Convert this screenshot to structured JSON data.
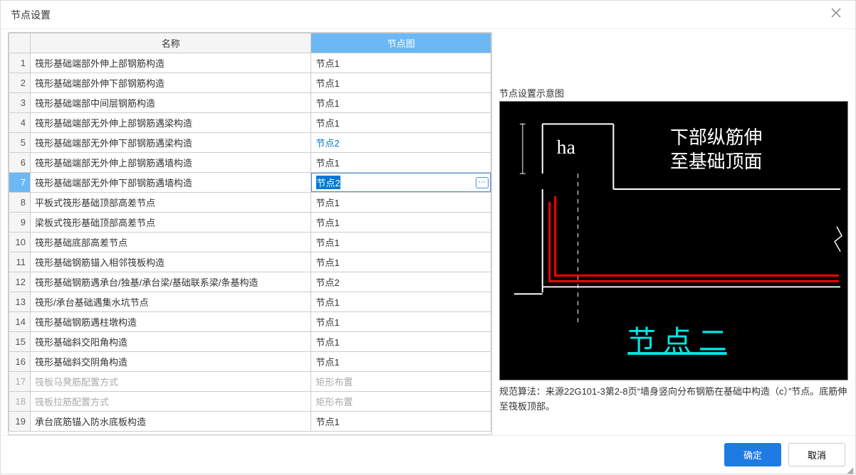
{
  "dialog": {
    "title": "节点设置",
    "ok": "确定",
    "cancel": "取消"
  },
  "table": {
    "headers": {
      "index": "",
      "name": "名称",
      "node": "节点图"
    },
    "rows": [
      {
        "idx": "1",
        "name": "筏形基础端部外伸上部钢筋构造",
        "val": "节点1",
        "state": ""
      },
      {
        "idx": "2",
        "name": "筏形基础端部外伸下部钢筋构造",
        "val": "节点1",
        "state": ""
      },
      {
        "idx": "3",
        "name": "筏形基础端部中间层钢筋构造",
        "val": "节点1",
        "state": ""
      },
      {
        "idx": "4",
        "name": "筏形基础端部无外伸上部钢筋遇梁构造",
        "val": "节点1",
        "state": ""
      },
      {
        "idx": "5",
        "name": "筏形基础端部无外伸下部钢筋遇梁构造",
        "val": "节点2",
        "state": "blue-text"
      },
      {
        "idx": "6",
        "name": "筏形基础端部无外伸上部钢筋遇墙构造",
        "val": "节点1",
        "state": ""
      },
      {
        "idx": "7",
        "name": "筏形基础端部无外伸下部钢筋遇墙构造",
        "val": "节点2",
        "state": "editing"
      },
      {
        "idx": "8",
        "name": "平板式筏形基础顶部高差节点",
        "val": "节点1",
        "state": ""
      },
      {
        "idx": "9",
        "name": "梁板式筏形基础顶部高差节点",
        "val": "节点1",
        "state": ""
      },
      {
        "idx": "10",
        "name": "筏形基础底部高差节点",
        "val": "节点1",
        "state": ""
      },
      {
        "idx": "11",
        "name": "筏形基础钢筋锚入相邻筏板构造",
        "val": "节点1",
        "state": ""
      },
      {
        "idx": "12",
        "name": "筏形基础钢筋遇承台/独基/承台梁/基础联系梁/条基构造",
        "val": "节点2",
        "state": ""
      },
      {
        "idx": "13",
        "name": "筏形/承台基础遇集水坑节点",
        "val": "节点1",
        "state": ""
      },
      {
        "idx": "14",
        "name": "筏形基础钢筋遇柱墩构造",
        "val": "节点1",
        "state": ""
      },
      {
        "idx": "15",
        "name": "筏形基础斜交阳角构造",
        "val": "节点1",
        "state": ""
      },
      {
        "idx": "16",
        "name": "筏形基础斜交阴角构造",
        "val": "节点1",
        "state": ""
      },
      {
        "idx": "17",
        "name": "筏板马凳筋配置方式",
        "val": "矩形布置",
        "state": "disabled"
      },
      {
        "idx": "18",
        "name": "筏板拉筋配置方式",
        "val": "矩形布置",
        "state": "disabled"
      },
      {
        "idx": "19",
        "name": "承台底筋锚入防水底板构造",
        "val": "节点1",
        "state": ""
      }
    ]
  },
  "preview": {
    "caption": "节点设置示意图",
    "label_ha": "ha",
    "label_top": "下部纵筋伸\n至基础顶面",
    "label_bottom": "节点二",
    "note": "规范算法：来源22G101-3第2-8页“墙身竖向分布钢筋在基础中构造（c）”节点。底筋伸至筏板顶部。"
  }
}
